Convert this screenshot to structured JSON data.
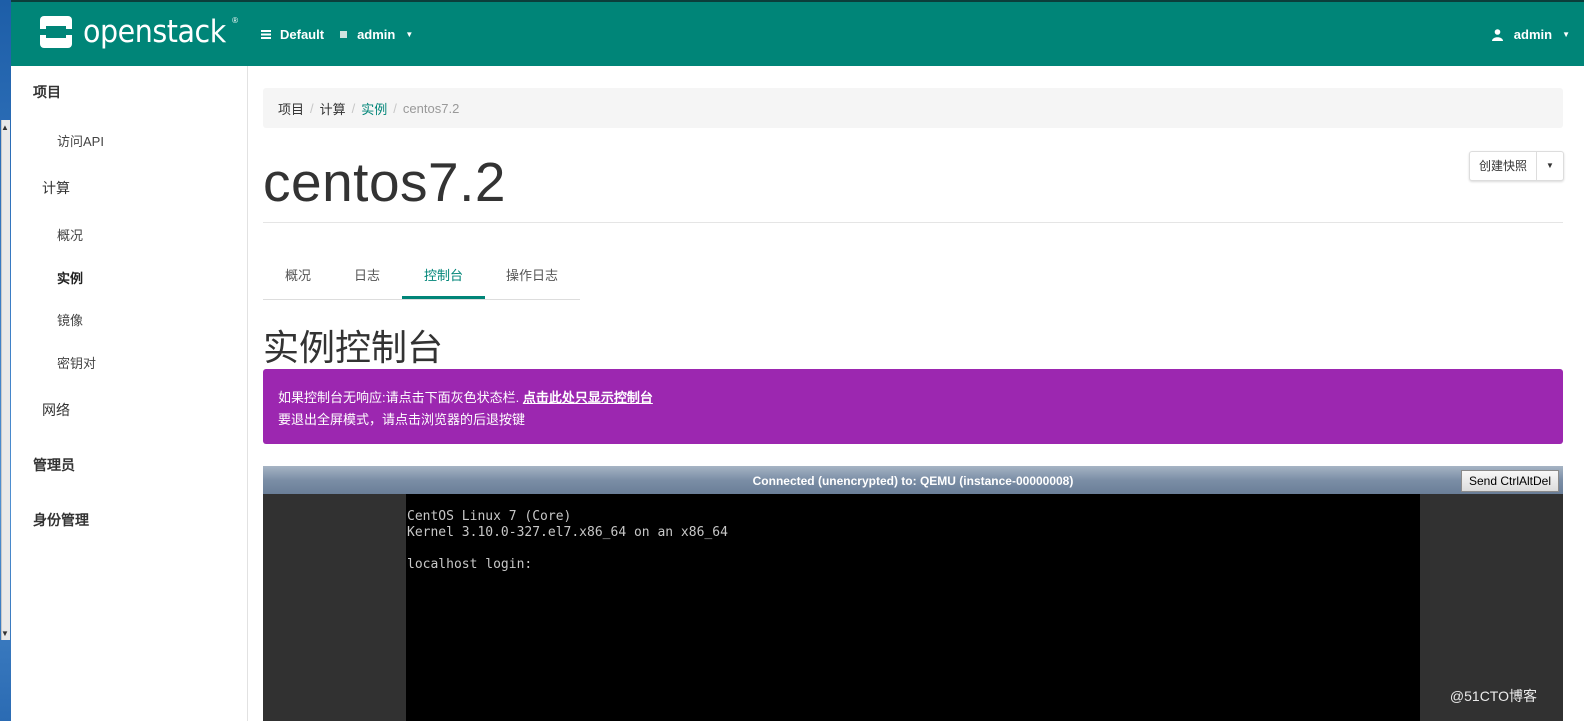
{
  "brand": {
    "name": "openstack",
    "tm": "®"
  },
  "context": {
    "domain": "Default",
    "project": "admin"
  },
  "user": {
    "name": "admin"
  },
  "sidebar": {
    "items": [
      {
        "label": "项目",
        "level": 1
      },
      {
        "label": "访问API",
        "level": 3
      },
      {
        "label": "计算",
        "level": 2
      },
      {
        "label": "概况",
        "level": 3
      },
      {
        "label": "实例",
        "level": 3,
        "active": true
      },
      {
        "label": "镜像",
        "level": 3
      },
      {
        "label": "密钥对",
        "level": 3
      },
      {
        "label": "网络",
        "level": 2
      },
      {
        "label": "管理员",
        "level": 1
      },
      {
        "label": "身份管理",
        "level": 1
      }
    ]
  },
  "breadcrumb": [
    "项目",
    "计算",
    "实例",
    "centos7.2"
  ],
  "page": {
    "title": "centos7.2",
    "snapshot_button": "创建快照",
    "tabs": [
      "概况",
      "日志",
      "控制台",
      "操作日志"
    ],
    "active_tab": "控制台",
    "section_title": "实例控制台"
  },
  "alert": {
    "line1_prefix": "如果控制台无响应:请点击下面灰色状态栏.",
    "line1_link": "点击此处只显示控制台",
    "line2": "要退出全屏模式，请点击浏览器的后退按键"
  },
  "console": {
    "status": "Connected (unencrypted) to: QEMU (instance-00000008)",
    "send_button": "Send CtrlAltDel",
    "lines": [
      "CentOS Linux 7 (Core)",
      "Kernel 3.10.0-327.el7.x86_64 on an x86_64",
      "",
      "localhost login:"
    ]
  },
  "watermark": "@51CTO博客",
  "colors": {
    "navbar": "#008578",
    "accent": "#008578",
    "alert": "#9c27b0"
  }
}
